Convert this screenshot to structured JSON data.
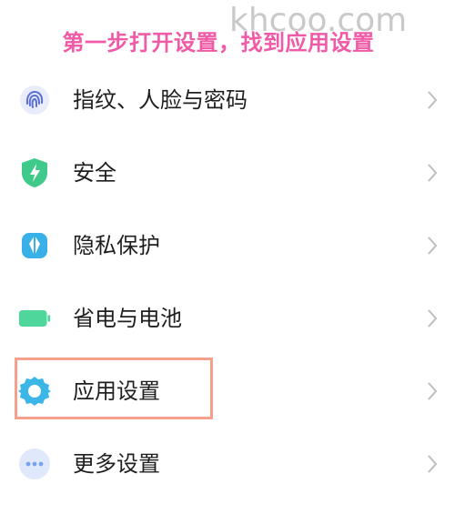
{
  "watermark": "khcoo.com",
  "banner": "第一步打开设置，找到应用设置",
  "colors": {
    "banner": "#f05aa6",
    "highlight_box": "#f4a08a",
    "text": "#1f1f1f",
    "chevron": "#bdbdbd"
  },
  "menu": {
    "items": [
      {
        "label": "指纹、人脸与密码",
        "icon": "fingerprint-icon"
      },
      {
        "label": "安全",
        "icon": "security-shield-icon"
      },
      {
        "label": "隐私保护",
        "icon": "privacy-icon"
      },
      {
        "label": "省电与电池",
        "icon": "battery-icon"
      },
      {
        "label": "应用设置",
        "icon": "app-settings-gear-icon",
        "highlighted": true
      },
      {
        "label": "更多设置",
        "icon": "more-settings-icon"
      }
    ]
  }
}
